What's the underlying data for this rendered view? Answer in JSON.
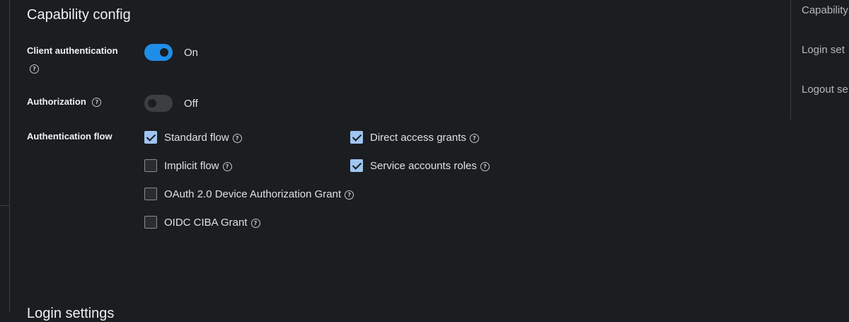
{
  "capability_config": {
    "title": "Capability config",
    "client_authentication": {
      "label": "Client authentication",
      "state": "On",
      "enabled": true
    },
    "authorization": {
      "label": "Authorization",
      "state": "Off",
      "enabled": false
    },
    "authentication_flow": {
      "label": "Authentication flow",
      "options": [
        {
          "label": "Standard flow",
          "checked": true
        },
        {
          "label": "Direct access grants",
          "checked": true
        },
        {
          "label": "Implicit flow",
          "checked": false
        },
        {
          "label": "Service accounts roles",
          "checked": true
        },
        {
          "label": "OAuth 2.0 Device Authorization Grant",
          "checked": false
        },
        {
          "label": "OIDC CIBA Grant",
          "checked": false
        }
      ]
    }
  },
  "next_section": {
    "title": "Login settings"
  },
  "jump_links": [
    "Capability",
    "Login set",
    "Logout se"
  ],
  "help_icon": "question-circle-icon",
  "colors": {
    "background": "#1b1d21",
    "accent": "#1f8ee8",
    "checkbox_checked": "#9fc5f0"
  }
}
